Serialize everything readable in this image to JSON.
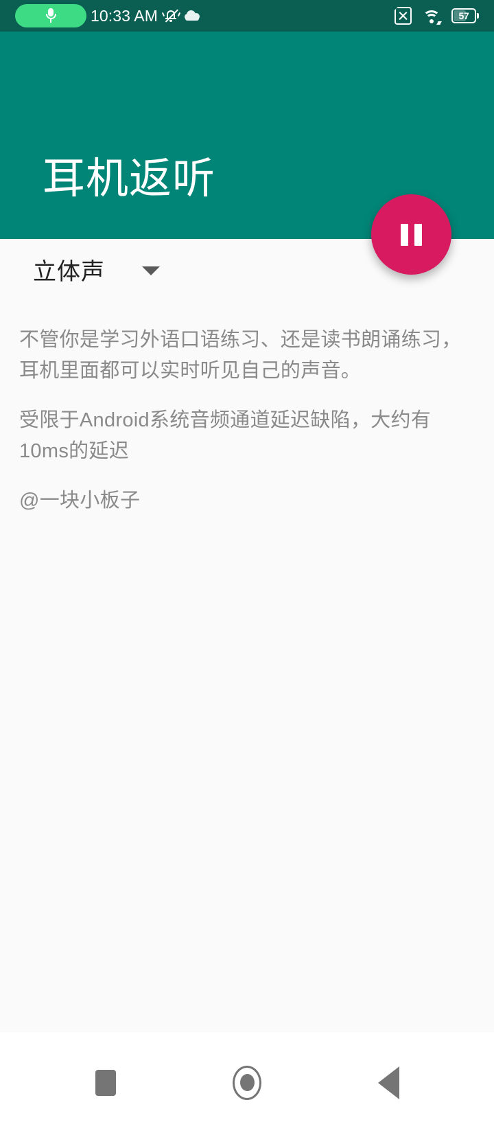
{
  "status_bar": {
    "mic_indicator": "microphone-active",
    "time": "10:33 AM",
    "silent_icon": "bell-muted",
    "weather_icon": "cloud",
    "sim_icon": "sim-card-no-signal",
    "wifi_icon": "wifi",
    "battery_level": "57",
    "background_color": "#0A5F52",
    "mic_pill_color": "#3DDC84"
  },
  "app_bar": {
    "title": "耳机返听",
    "background_color": "#008577",
    "text_color": "#FFFFFF"
  },
  "fab": {
    "icon": "pause-icon",
    "label": "暂停",
    "color": "#D81B60"
  },
  "content": {
    "spinner": {
      "selected": "立体声",
      "caret_icon": "chevron-down-icon",
      "options": [
        "立体声"
      ]
    },
    "paragraphs": [
      "不管你是学习外语口语练习、还是读书朗诵练习，耳机里面都可以实时听见自己的声音。",
      " 受限于Android系统音频通道延迟缺陷，大约有10ms的延迟",
      " @一块小板子"
    ],
    "background_color": "#FAFAFA",
    "text_color": "#8A8A8A"
  },
  "navigation_bar": {
    "recents_label": "最近任务",
    "home_label": "主页",
    "back_label": "返回",
    "background_color": "#FFFFFF",
    "icon_color": "#757575"
  }
}
